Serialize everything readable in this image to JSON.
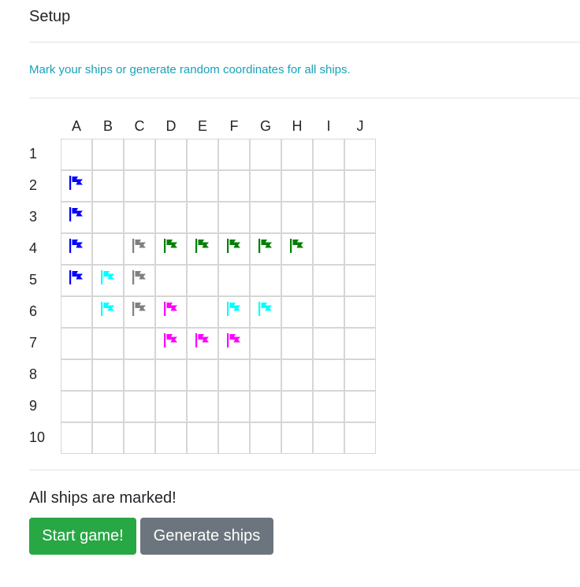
{
  "setup": {
    "title": "Setup",
    "instructions": "Mark your ships or generate random coordinates for all ships."
  },
  "board": {
    "columns": [
      "A",
      "B",
      "C",
      "D",
      "E",
      "F",
      "G",
      "H",
      "I",
      "J"
    ],
    "rows": [
      "1",
      "2",
      "3",
      "4",
      "5",
      "6",
      "7",
      "8",
      "9",
      "10"
    ],
    "ships": [
      {
        "color": "#0000ff",
        "cells": [
          "A2",
          "A3",
          "A4",
          "A5"
        ]
      },
      {
        "color": "#808080",
        "cells": [
          "C4",
          "C5",
          "C6"
        ]
      },
      {
        "color": "#008000",
        "cells": [
          "D4",
          "E4",
          "F4",
          "G4",
          "H4"
        ]
      },
      {
        "color": "#00ffff",
        "cells": [
          "B5",
          "B6"
        ]
      },
      {
        "color": "#00ffff",
        "cells": [
          "F6",
          "G6"
        ]
      },
      {
        "color": "#ff00ff",
        "cells": [
          "D6",
          "D7",
          "E7",
          "F7"
        ]
      }
    ]
  },
  "status": {
    "message": "All ships are marked!"
  },
  "actions": {
    "start_label": "Start game!",
    "generate_label": "Generate ships"
  },
  "icons": {
    "ship_marker": "flag-icon"
  }
}
